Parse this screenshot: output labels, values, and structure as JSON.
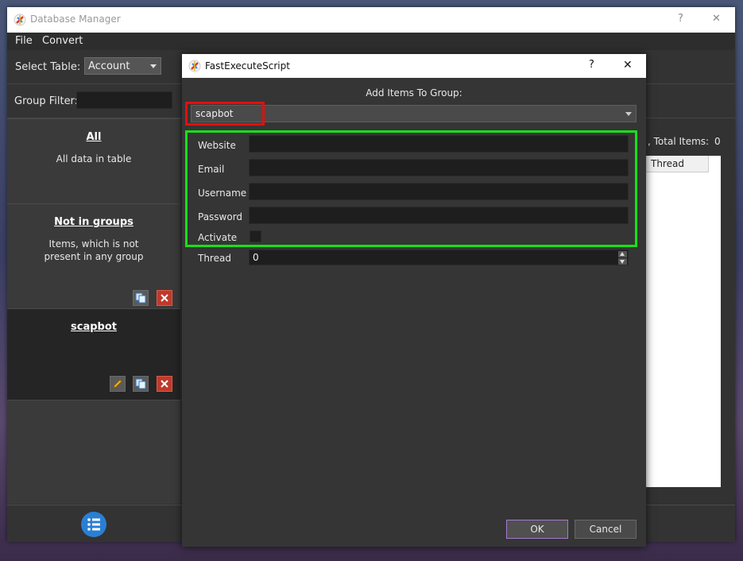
{
  "main": {
    "title": "Database Manager",
    "help": "?",
    "close": "✕",
    "menu": [
      "File",
      "Convert"
    ],
    "select_table_label": "Select Table:",
    "select_table_value": "Account",
    "group_filter_label": "Group Filter:",
    "total_items_label": ", Total Items:",
    "total_items_value": "0",
    "table_header": "Thread",
    "groups": [
      {
        "title": "All",
        "desc": "All data in table"
      },
      {
        "title": "Not in groups",
        "desc": "Items, which is not present in any group"
      },
      {
        "title": "scapbot",
        "desc": ""
      }
    ]
  },
  "dialog": {
    "title": "FastExecuteScript",
    "help": "?",
    "close": "✕",
    "heading": "Add Items To Group:",
    "group_select": "scapbot",
    "fields": {
      "website": {
        "label": "Website",
        "value": ""
      },
      "email": {
        "label": "Email",
        "value": ""
      },
      "username": {
        "label": "Username",
        "value": ""
      },
      "password": {
        "label": "Password",
        "value": ""
      },
      "activate": {
        "label": "Activate"
      },
      "thread": {
        "label": "Thread",
        "value": "0"
      }
    },
    "ok": "OK",
    "cancel": "Cancel"
  },
  "colors": {
    "highlight_red": "#e01010",
    "highlight_green": "#18e018",
    "list_icon_blue": "#2a7fd4"
  }
}
